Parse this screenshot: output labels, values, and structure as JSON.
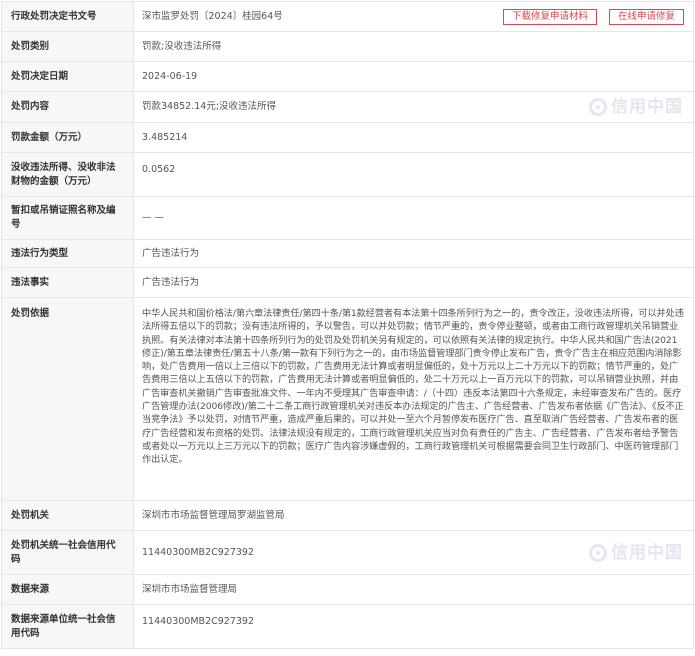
{
  "rows": [
    {
      "label": "行政处罚决定书文号",
      "value": "深市监罗处罚〔2024〕桂园64号"
    },
    {
      "label": "处罚类别",
      "value": "罚款;没收违法所得"
    },
    {
      "label": "处罚决定日期",
      "value": "2024-06-19"
    },
    {
      "label": "处罚内容",
      "value": "罚款34852.14元;没收违法所得"
    },
    {
      "label": "罚款金额（万元）",
      "value": "3.485214"
    },
    {
      "label": "没收违法所得、没收非法财物的金额（万元）",
      "value": "0.0562"
    },
    {
      "label": "暂扣或吊销证照名称及编号",
      "value": "— —"
    },
    {
      "label": "违法行为类型",
      "value": "广告违法行为"
    },
    {
      "label": "违法事实",
      "value": "广告违法行为"
    },
    {
      "label": "处罚依据",
      "value": "中华人民共和国价格法/第六章法律责任/第四十条/第1款经营者有本法第十四条所列行为之一的，责令改正，没收违法所得，可以并处违法所得五倍以下的罚款；没有违法所得的，予以警告，可以并处罚款；情节严重的，责令停业整顿，或者由工商行政管理机关吊销营业执照。有关法律对本法第十四条所列行为的处罚及处罚机关另有规定的，可以依照有关法律的规定执行。中华人民共和国广告法(2021修正)/第五章法律责任/第五十八条/第一款有下列行为之一的，由市场监督管理部门责令停止发布广告，责令广告主在相应范围内消除影响，处广告费用一倍以上三倍以下的罚款，广告费用无法计算或者明显偏低的，处十万元以上二十万元以下的罚款；情节严重的，处广告费用三倍以上五倍以下的罚款，广告费用无法计算或者明显偏低的，处二十万元以上一百万元以下的罚款，可以吊销营业执照，并由广告审查机关撤销广告审查批准文件、一年内不受理其广告审查申请：/（十四）违反本法第四十六条规定，未经审查发布广告的。医疗广告管理办法(2006修改)/第二十二条工商行政管理机关对违反本办法规定的广告主、广告经营者、广告发布者依据《广告法》、《反不正当竞争法》予以处罚，对情节严重，造成严重后果的，可以并处一至六个月暂停发布医疗广告、直至取消广告经营者、广告发布者的医疗广告经营和发布资格的处罚。法律法规没有规定的，工商行政管理机关应当对负有责任的广告主、广告经营者、广告发布者给予警告或者处以一万元以上三万元以下的罚款；医疗广告内容涉嫌虚假的，工商行政管理机关可根据需要会同卫生行政部门、中医药管理部门作出认定。"
    },
    {
      "label": "处罚机关",
      "value": "深圳市市场监督管理局罗湖监管局"
    },
    {
      "label": "处罚机关统一社会信用代码",
      "value": "11440300MB2C927392"
    },
    {
      "label": "数据来源",
      "value": "深圳市市场监督管理局"
    },
    {
      "label": "数据来源单位统一社会信用代码",
      "value": "11440300MB2C927392"
    }
  ],
  "actions": {
    "download_label": "下载修复申请材料",
    "online_label": "在线申请修复"
  },
  "watermark": {
    "text": "信用中国",
    "icon": "credit-china-logo-icon"
  },
  "colors": {
    "accent": "#e0454b",
    "label_bg": "#f6f7f9",
    "border": "#e6e6e6"
  }
}
